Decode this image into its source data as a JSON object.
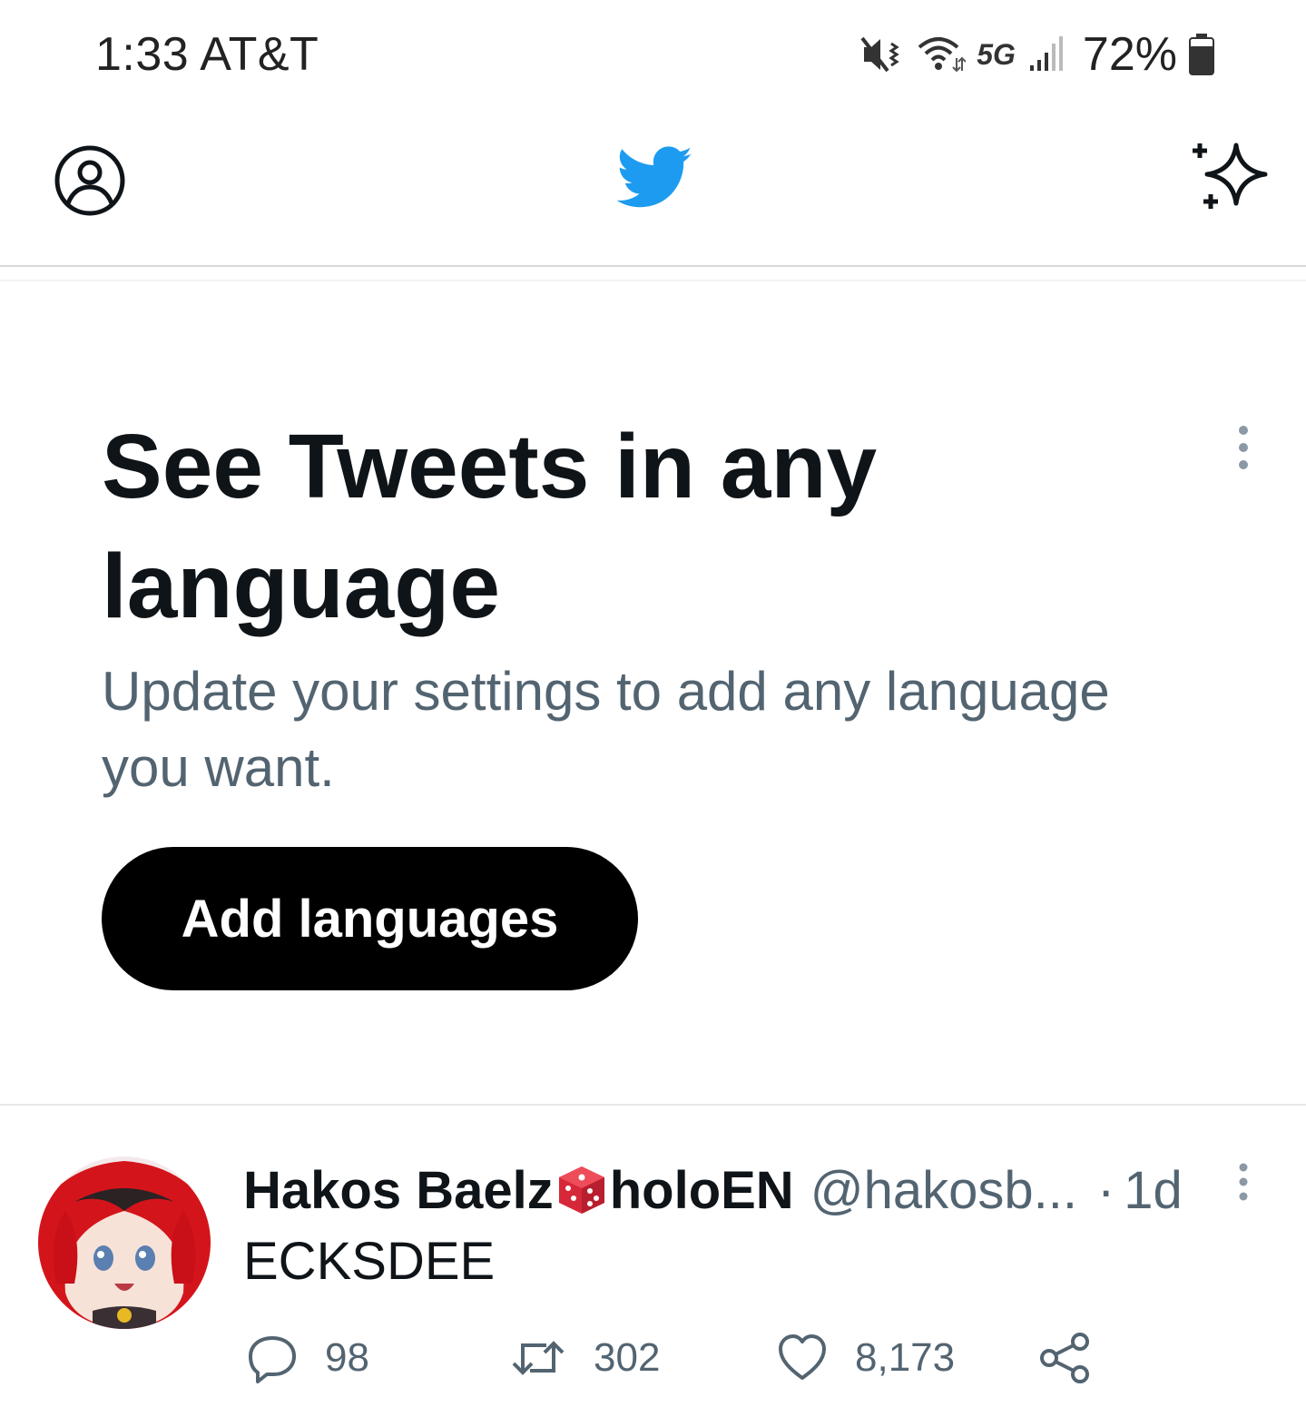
{
  "status_bar": {
    "time_carrier": "1:33 AT&T",
    "network": "5G",
    "battery": "72%",
    "icons": [
      "mute-vibrate-icon",
      "wifi-icon",
      "signal-icon",
      "battery-icon"
    ]
  },
  "app_bar": {
    "icons": [
      "profile-icon",
      "twitter-bird-icon",
      "sparkle-icon"
    ],
    "brand_color": "#1d9bf0"
  },
  "language_prompt": {
    "title": "See Tweets in any language",
    "subtitle": "Update your settings to add any language you want.",
    "button_label": "Add languages"
  },
  "tweet": {
    "display_name": "Hakos Baelz",
    "display_name_suffix": "holoEN",
    "handle": "@hakosb...",
    "separator": "·",
    "time": "1d",
    "text": "ECKSDEE",
    "replies": "98",
    "retweets": "302",
    "likes": "8,173",
    "icons": [
      "reply-icon",
      "retweet-icon",
      "like-icon",
      "share-icon",
      "dice-emoji-icon"
    ]
  },
  "colors": {
    "text_primary": "#0f1419",
    "text_secondary": "#536471",
    "button_bg": "#000000",
    "button_text": "#ffffff"
  }
}
